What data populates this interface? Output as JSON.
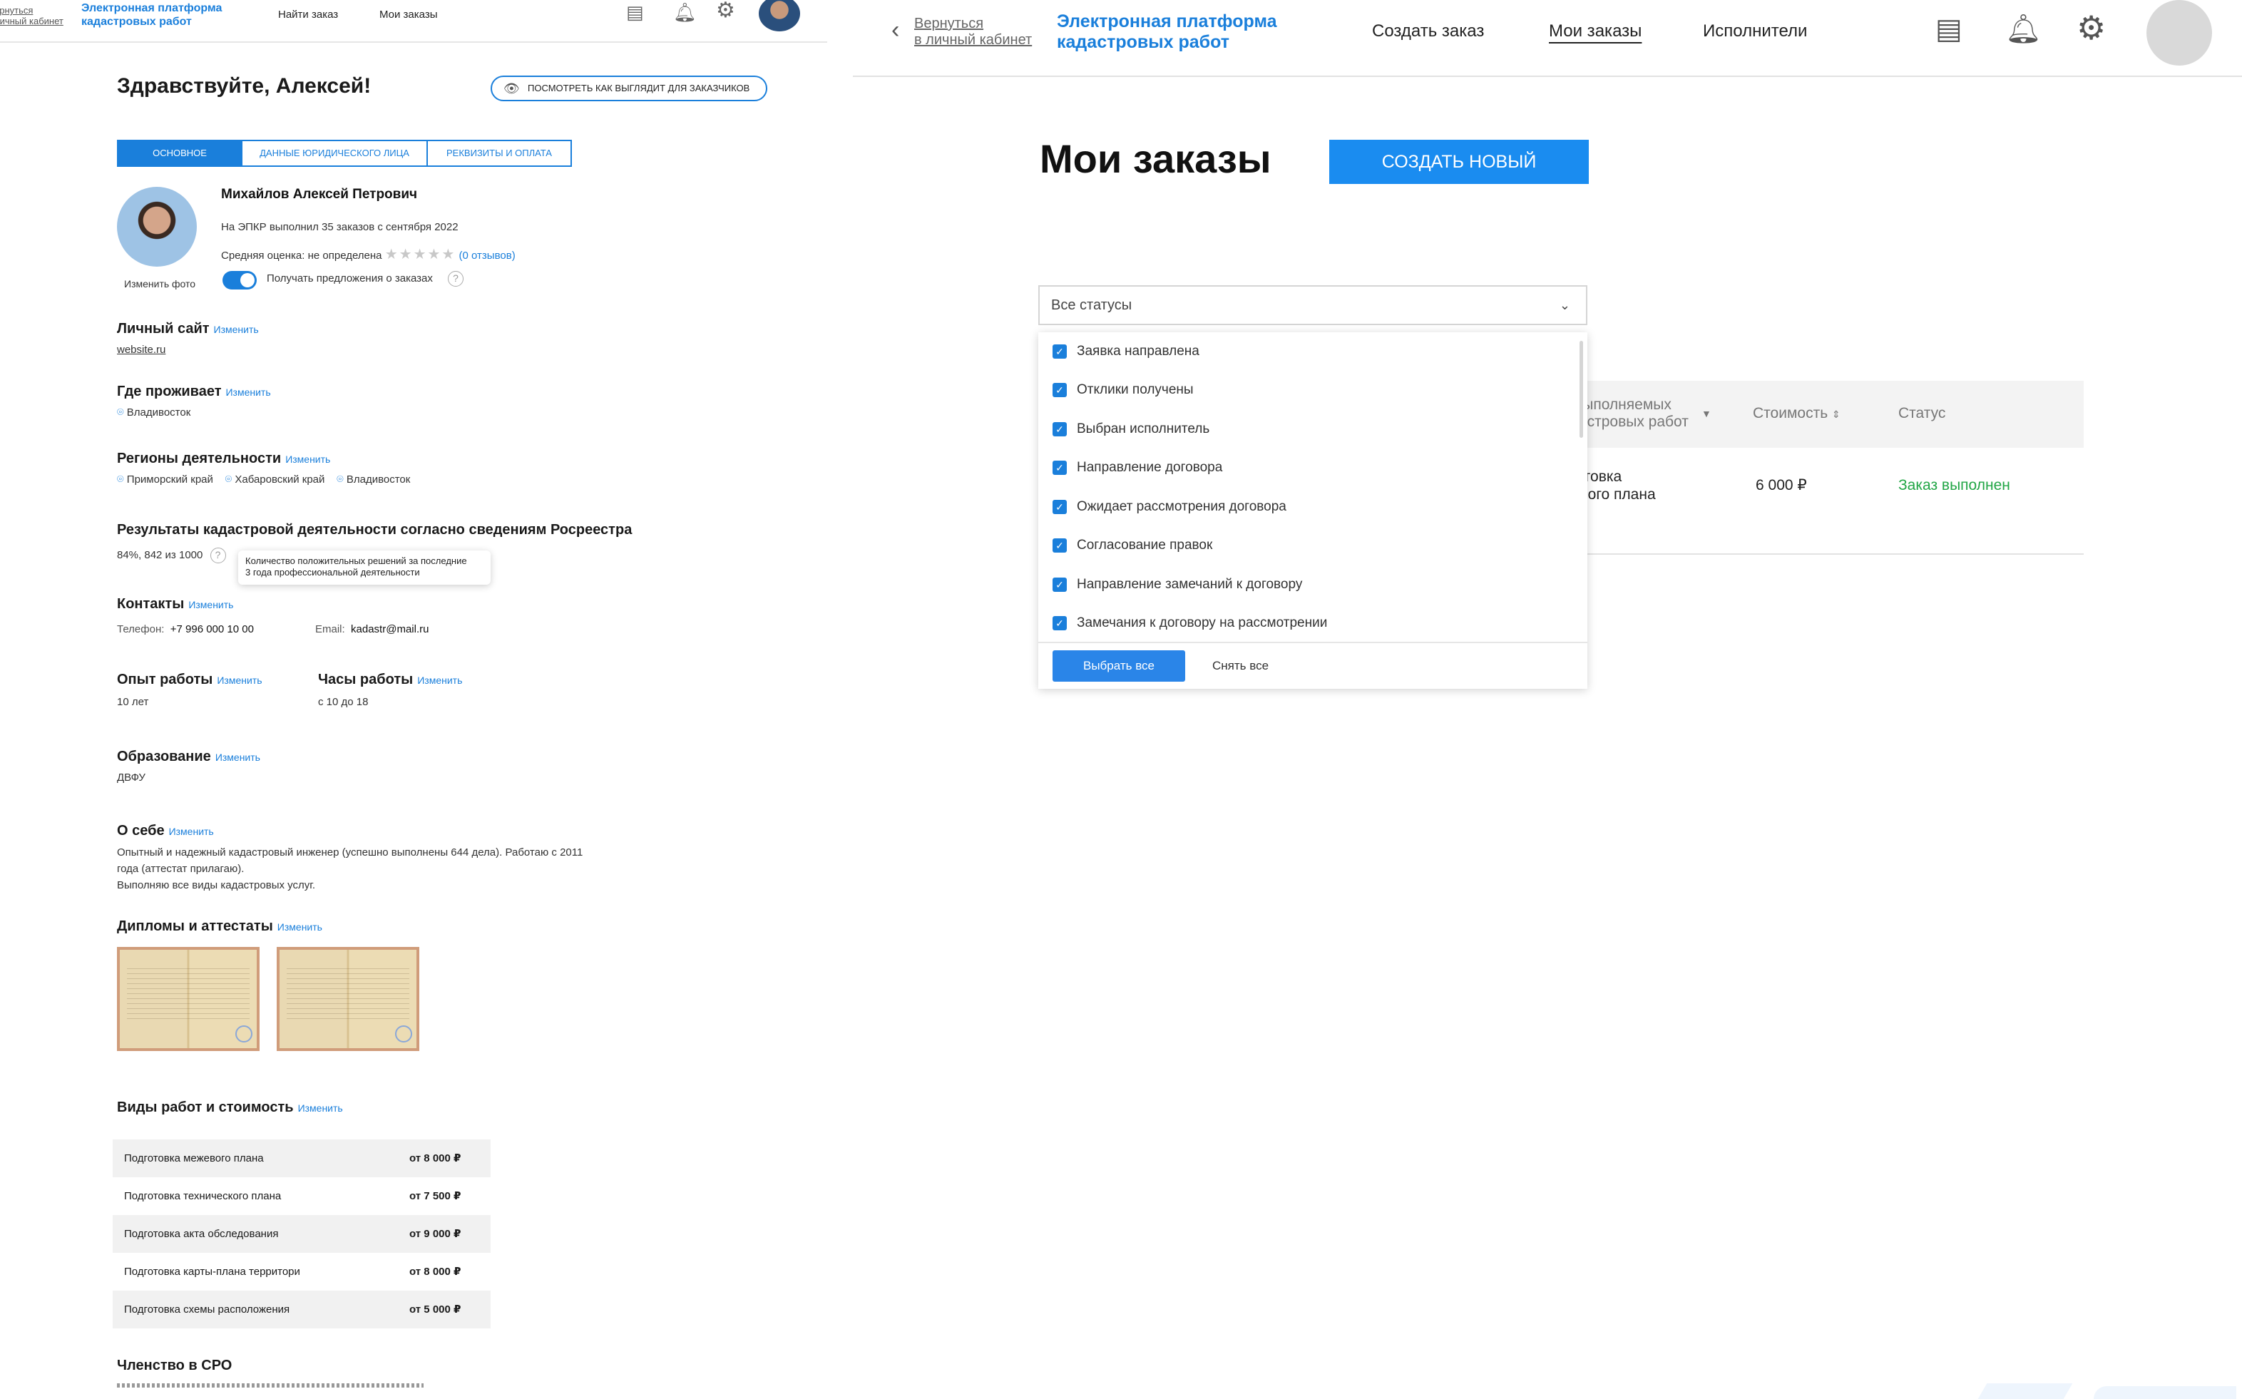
{
  "left": {
    "header": {
      "back_line1": "ернуться",
      "back_line2": "личный кабинет",
      "brand_line1": "Электронная платформа",
      "brand_line2": "кадастровых работ",
      "nav_find": "Найти заказ",
      "nav_orders": "Мои заказы"
    },
    "greeting": "Здравствуйте, Алексей!",
    "preview_button": "ПОСМОТРЕТЬ КАК ВЫГЛЯДИТ ДЛЯ ЗАКАЗЧИКОВ",
    "tabs": [
      "ОСНОВНОЕ",
      "ДАННЫЕ ЮРИДИЧЕСКОГО ЛИЦА",
      "РЕКВИЗИТЫ И ОПЛАТА"
    ],
    "profile": {
      "name": "Михайлов Алексей Петрович",
      "stats": "На ЭПКР выполнил 35 заказов  с сентября 2022",
      "rating_label": "Средняя оценка: не определена",
      "reviews": "(0 отзывов)",
      "change_photo": "Изменить фото",
      "receive_offers": "Получать предложения о заказах"
    },
    "edit": "Изменить",
    "website": {
      "title": "Личный сайт",
      "value": "website.ru"
    },
    "residence": {
      "title": "Где проживает",
      "value": "Владивосток"
    },
    "regions": {
      "title": "Регионы деятельности",
      "items": [
        "Приморский край",
        "Хабаровский край",
        "Владивосток"
      ]
    },
    "results": {
      "title": "Результаты кадастровой деятельности согласно сведениям Росреестра",
      "value": "84%, 842 из 1000",
      "tooltip_line1": "Количество положительных решений за последние",
      "tooltip_line2": "3 года профессиональной деятельности"
    },
    "contacts": {
      "title": "Контакты",
      "phone_label": "Телефон:",
      "phone": "+7 996 000 10 00",
      "email_label": "Email:",
      "email": "kadastr@mail.ru"
    },
    "experience": {
      "title": "Опыт работы",
      "value": "10 лет"
    },
    "hours": {
      "title": "Часы работы",
      "value": "с 10 до 18"
    },
    "education": {
      "title": "Образование",
      "value": "ДВФУ"
    },
    "about": {
      "title": "О себе",
      "line1": "Опытный и надежный кадастровый инженер (успешно выполнены 644 дела). Работаю с 2011",
      "line2": "года (аттестат прилагаю).",
      "line3": "Выполняю все виды кадастровых услуг."
    },
    "diplomas": {
      "title": "Дипломы и аттестаты"
    },
    "works": {
      "title": "Виды работ и стоимость",
      "rows": [
        {
          "name": "Подготовка межевого плана",
          "price": "от 8 000 ₽"
        },
        {
          "name": "Подготовка технического плана",
          "price": "от 7 500 ₽"
        },
        {
          "name": "Подготовка акта обследования",
          "price": "от 9 000 ₽"
        },
        {
          "name": "Подготовка карты-плана территори",
          "price": "от 8 000 ₽"
        },
        {
          "name": "Подготовка схемы расположения",
          "price": "от 5 000 ₽"
        }
      ]
    },
    "sro": {
      "title": "Членство в СРО"
    }
  },
  "right": {
    "header": {
      "back_line1": "Вернуться",
      "back_line2": "в личный кабинет",
      "brand_line1": "Электронная платформа",
      "brand_line2": "кадастровых работ",
      "nav": [
        "Создать заказ",
        "Мои заказы",
        "Исполнители"
      ]
    },
    "title": "Мои заказы",
    "create_button": "СОЗДАТЬ НОВЫЙ",
    "status_select": "Все статусы",
    "statuses": [
      "Заявка направлена",
      "Отклики получены",
      "Выбран исполнитель",
      "Направление договора",
      "Ожидает рассмотрения договора",
      "Согласование правок",
      "Направление замечаний к договору",
      "Замечания к договору на рассмотрении"
    ],
    "select_all": "Выбрать все",
    "clear_all": "Снять все",
    "table": {
      "col_work_line1": "д выполняемых",
      "col_work_line2": "адастровых работ",
      "col_cost": "Стоимость",
      "col_status": "Статус",
      "row_work_line1": "дготовка",
      "row_work_line2": "жевого плана",
      "row_cost": "6 000 ₽",
      "row_status": "Заказ выполнен"
    },
    "colors": {
      "accent": "#1a8cf0",
      "status_done": "#22a646"
    }
  }
}
